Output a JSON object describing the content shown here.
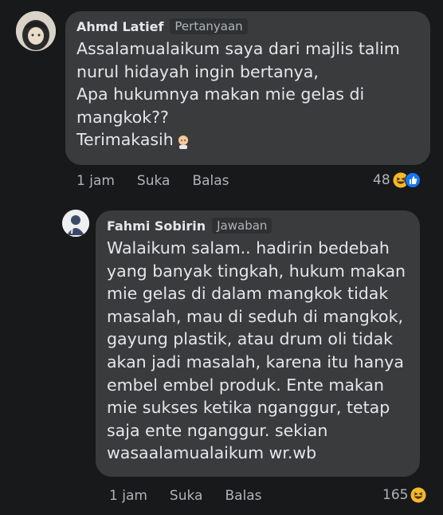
{
  "comment": {
    "author": "Ahmd Latief",
    "tag": "Pertanyaan",
    "lines": [
      "Assalamualaikum saya dari majlis talim",
      "nurul hidayah ingin bertanya,",
      "Apa hukumnya makan mie gelas di",
      "mangkok??",
      "Terimakasih"
    ],
    "time": "1 jam",
    "like_label": "Suka",
    "reply_label": "Balas",
    "reactions": "48"
  },
  "reply": {
    "author": "Fahmi Sobirin",
    "tag": "Jawaban",
    "lines": [
      "Walaikum salam.. hadirin bedebah",
      "yang banyak tingkah, hukum makan",
      "mie gelas di dalam mangkok tidak",
      "masalah, mau di seduh di mangkok,",
      "gayung plastik, atau drum oli tidak",
      "akan jadi masalah, karena itu hanya",
      "embel embel produk. Ente makan",
      "mie sukses ketika nganggur, tetap",
      "saja ente nganggur. sekian",
      "wasaalamualaikum wr.wb"
    ],
    "time": "1 jam",
    "like_label": "Suka",
    "reply_label": "Balas",
    "reactions": "165"
  },
  "colors": {
    "background": "#18191a",
    "bubble": "#3a3b3c",
    "haha_yellow": "#f7b928",
    "like_blue": "#1877f2"
  }
}
